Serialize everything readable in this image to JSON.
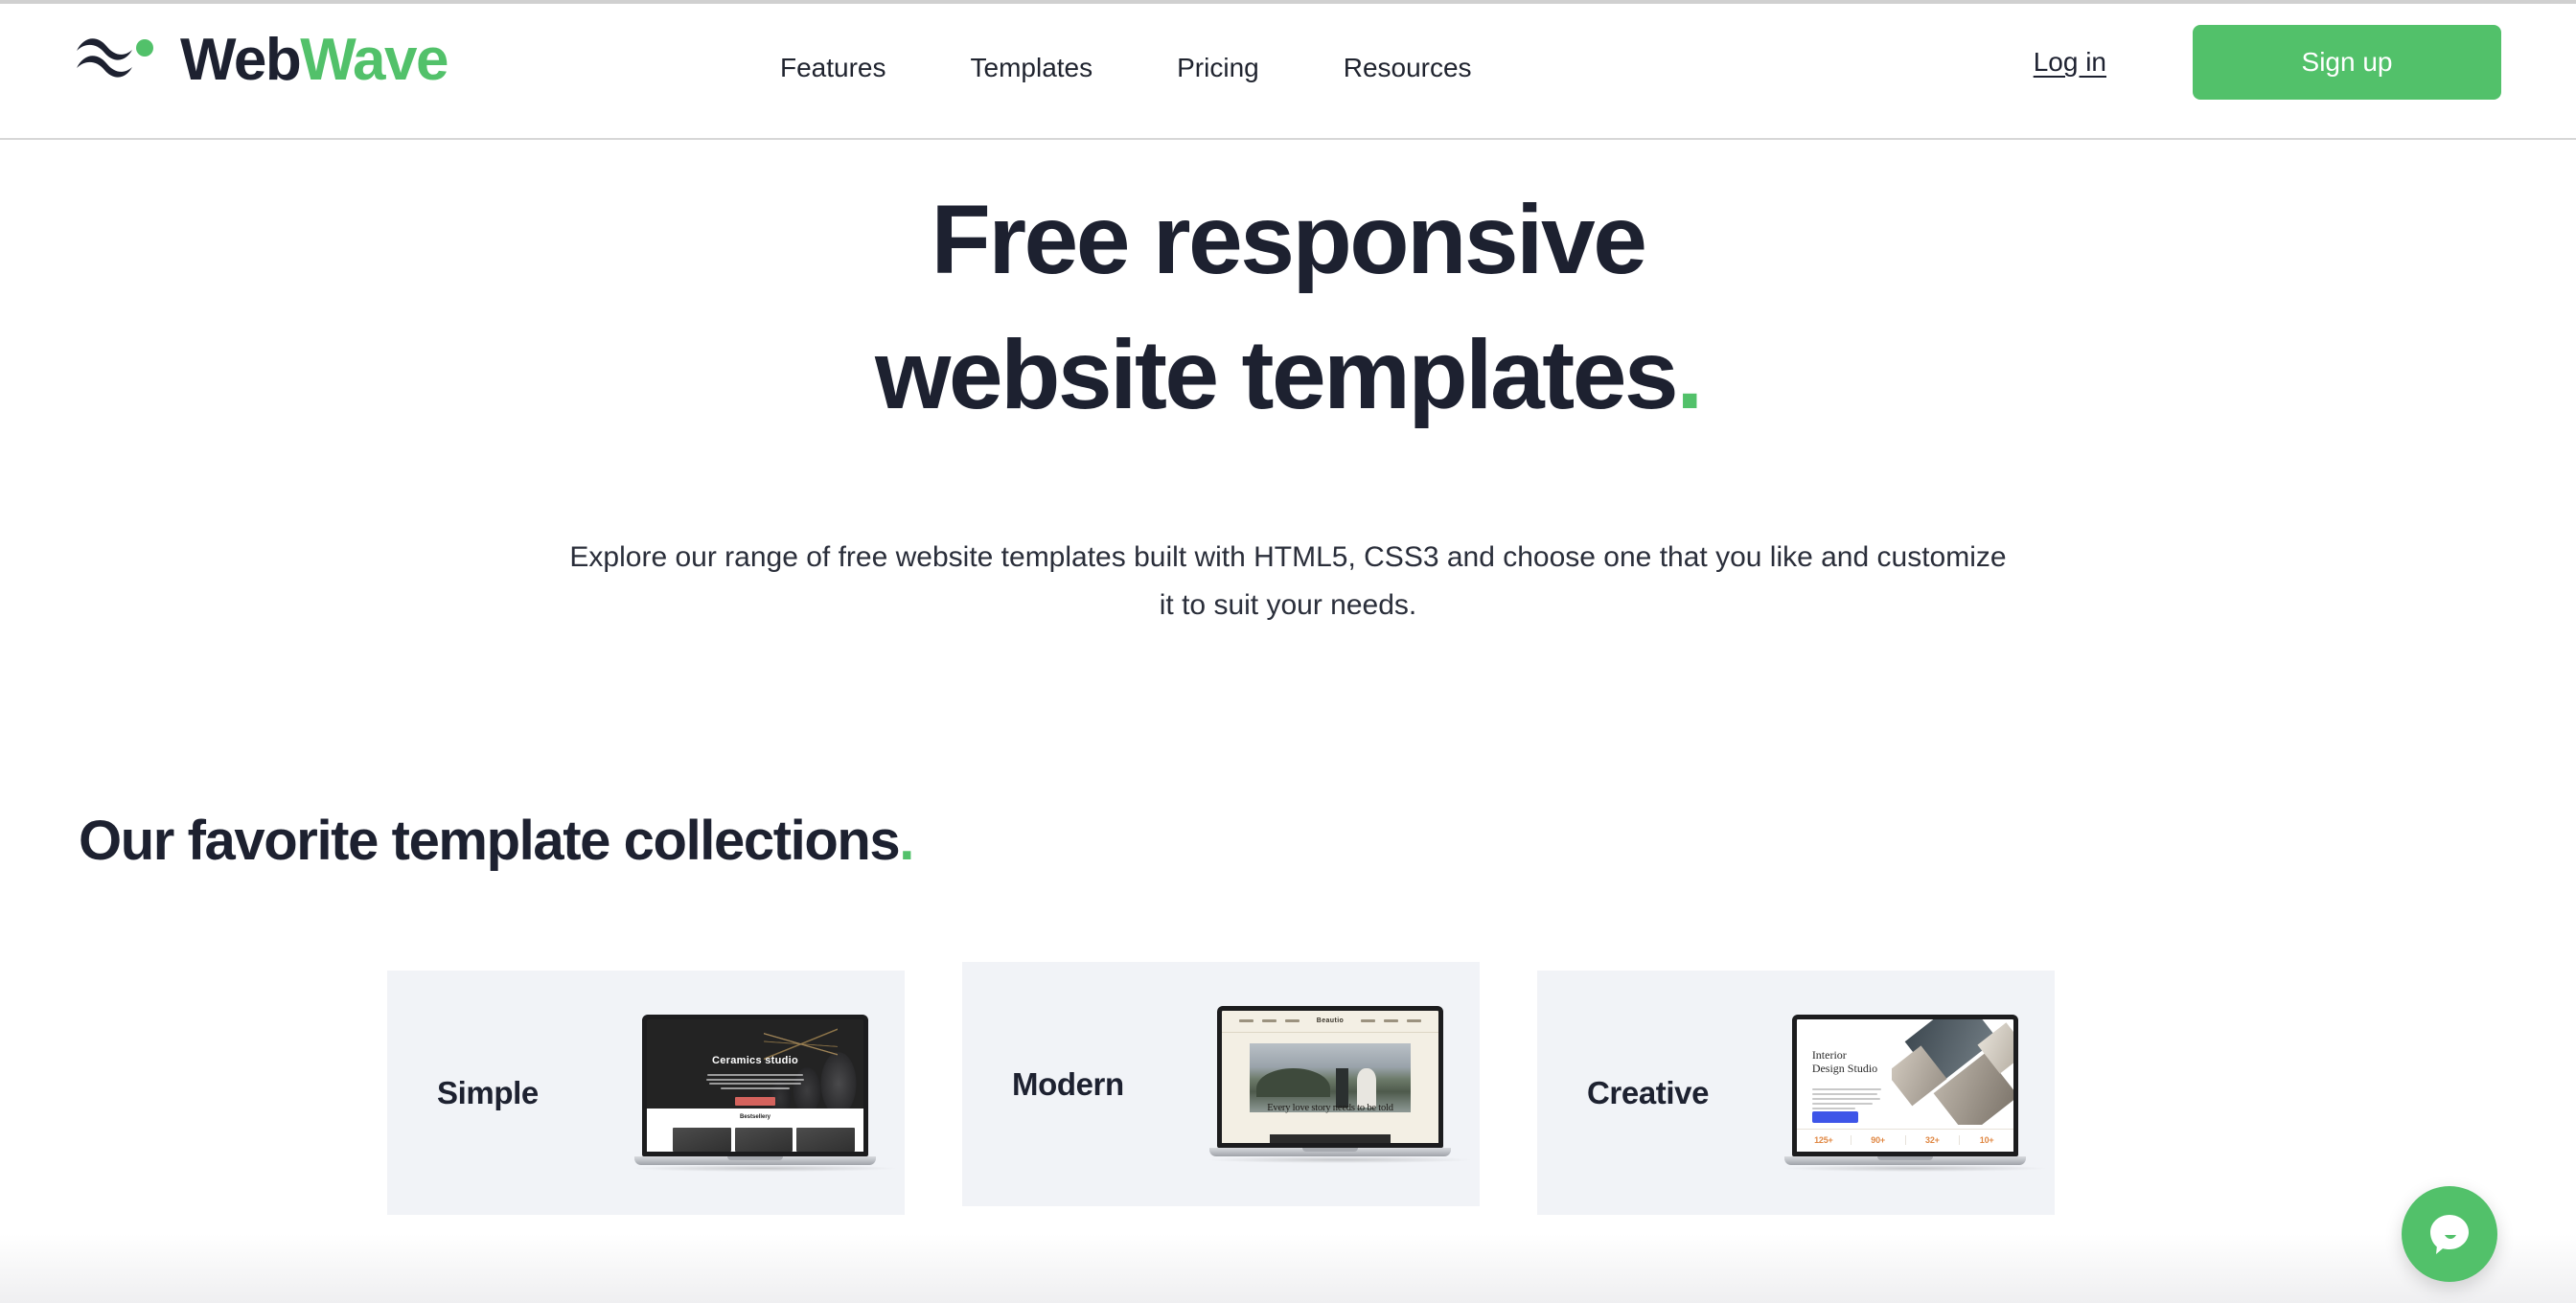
{
  "brand": {
    "name_part1": "Web",
    "name_part2": "Wave",
    "logo_icon": "wave-mark-icon",
    "accent_color": "#52c16a",
    "dark_color": "#1d2130"
  },
  "header": {
    "nav": [
      {
        "label": "Features"
      },
      {
        "label": "Templates"
      },
      {
        "label": "Pricing"
      },
      {
        "label": "Resources"
      }
    ],
    "login_label": "Log in",
    "signup_label": "Sign up"
  },
  "hero": {
    "title": "Free responsive\nwebsite templates",
    "title_accent": ".",
    "subtitle": "Explore our range of free website templates built with HTML5, CSS3 and choose one that you like and customize it to suit your needs."
  },
  "collections": {
    "heading": "Our favorite template collections",
    "heading_accent": ".",
    "cards": [
      {
        "label": "Simple",
        "preview": {
          "kind": "ceramics",
          "headline": "Ceramics studio",
          "section_label": "Bestsellery"
        }
      },
      {
        "label": "Modern",
        "preview": {
          "kind": "wedding",
          "brand": "Beautio",
          "caption": "Every love story needs to be told"
        }
      },
      {
        "label": "Creative",
        "preview": {
          "kind": "interior",
          "headline": "Interior\nDesign Studio",
          "stats": [
            "125+",
            "90+",
            "32+",
            "10+"
          ]
        }
      }
    ]
  },
  "chat": {
    "icon": "chat-bubble-icon",
    "color": "#52c16a"
  }
}
